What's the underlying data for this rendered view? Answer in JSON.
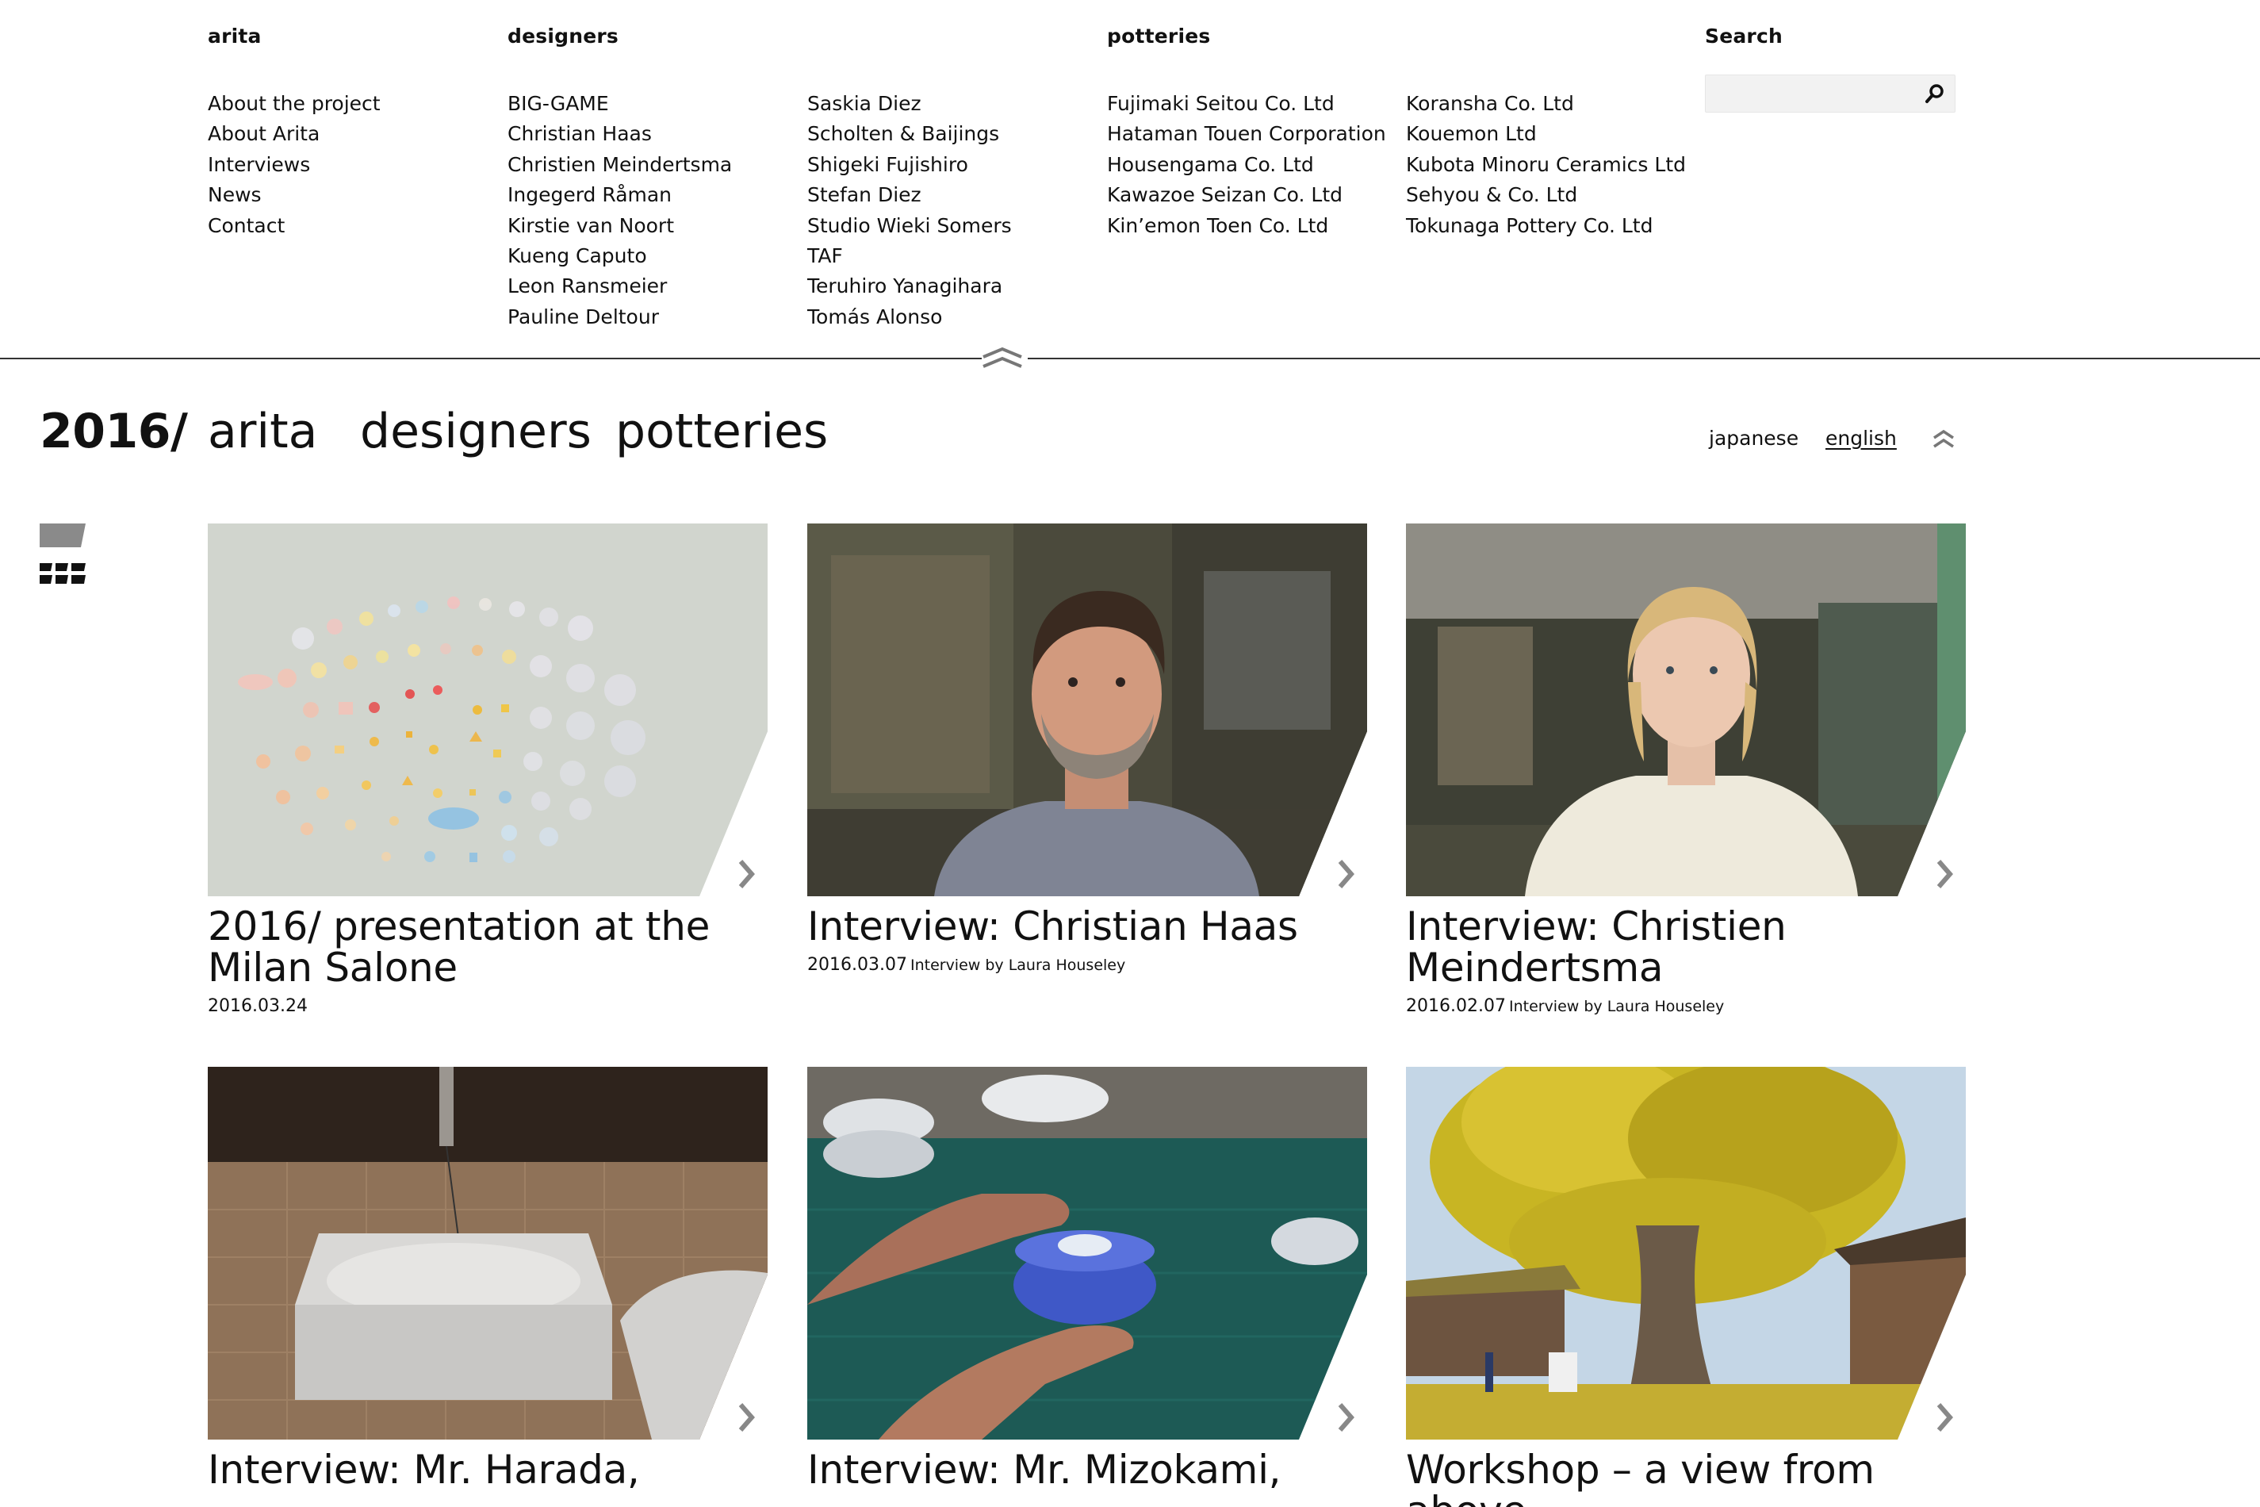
{
  "menu": {
    "arita": {
      "heading": "arita",
      "items": [
        "About the project",
        "About Arita",
        "Interviews",
        "News",
        "Contact"
      ]
    },
    "designers": {
      "heading": "designers",
      "col1": [
        "BIG-GAME",
        "Christian Haas",
        "Christien Meindertsma",
        "Ingegerd Råman",
        "Kirstie van Noort",
        "Kueng Caputo",
        "Leon Ransmeier",
        "Pauline Deltour"
      ],
      "col2": [
        "Saskia Diez",
        "Scholten & Baijings",
        "Shigeki Fujishiro",
        "Stefan Diez",
        "Studio Wieki Somers",
        "TAF",
        "Teruhiro Yanagihara",
        "Tomás Alonso"
      ]
    },
    "potteries": {
      "heading": "potteries",
      "col1": [
        "Fujimaki Seitou Co. Ltd",
        "Hataman Touen Corporation",
        "Housengama Co. Ltd",
        "Kawazoe Seizan Co. Ltd",
        "Kin’emon Toen Co. Ltd"
      ],
      "col2": [
        "Koransha Co. Ltd",
        "Kouemon Ltd",
        "Kubota Minoru Ceramics Ltd",
        "Sehyou & Co. Ltd",
        "Tokunaga Pottery Co. Ltd"
      ]
    },
    "search": {
      "heading": "Search",
      "value": "",
      "placeholder": ""
    }
  },
  "nav": {
    "year": "2016/",
    "links": [
      "arita",
      "designers",
      "potteries"
    ],
    "languages": [
      "japanese",
      "english"
    ],
    "active_language": "english"
  },
  "cards": [
    {
      "title": "2016/ presentation at the Milan Salone",
      "date": "2016.03.24",
      "byline": ""
    },
    {
      "title": "Interview: Christian Haas",
      "date": "2016.03.07",
      "byline": "Interview by Laura Houseley"
    },
    {
      "title": "Interview: Christien Meindertsma",
      "date": "2016.02.07",
      "byline": "Interview by Laura Houseley"
    },
    {
      "title": "Interview: Mr. Harada,",
      "date": "",
      "byline": ""
    },
    {
      "title": "Interview: Mr. Mizokami,",
      "date": "",
      "byline": ""
    },
    {
      "title": "Workshop – a view from above",
      "date": "",
      "byline": ""
    }
  ],
  "icons": {
    "search": "search-icon",
    "collapse": "double-chevron-up-icon",
    "next": "chevron-right-icon",
    "view_single": "single-view-icon",
    "view_grid": "grid-view-icon"
  },
  "colors": {
    "text": "#111111",
    "divider": "#333333",
    "arrow": "#888888",
    "search_bg": "#f2f2f2"
  }
}
